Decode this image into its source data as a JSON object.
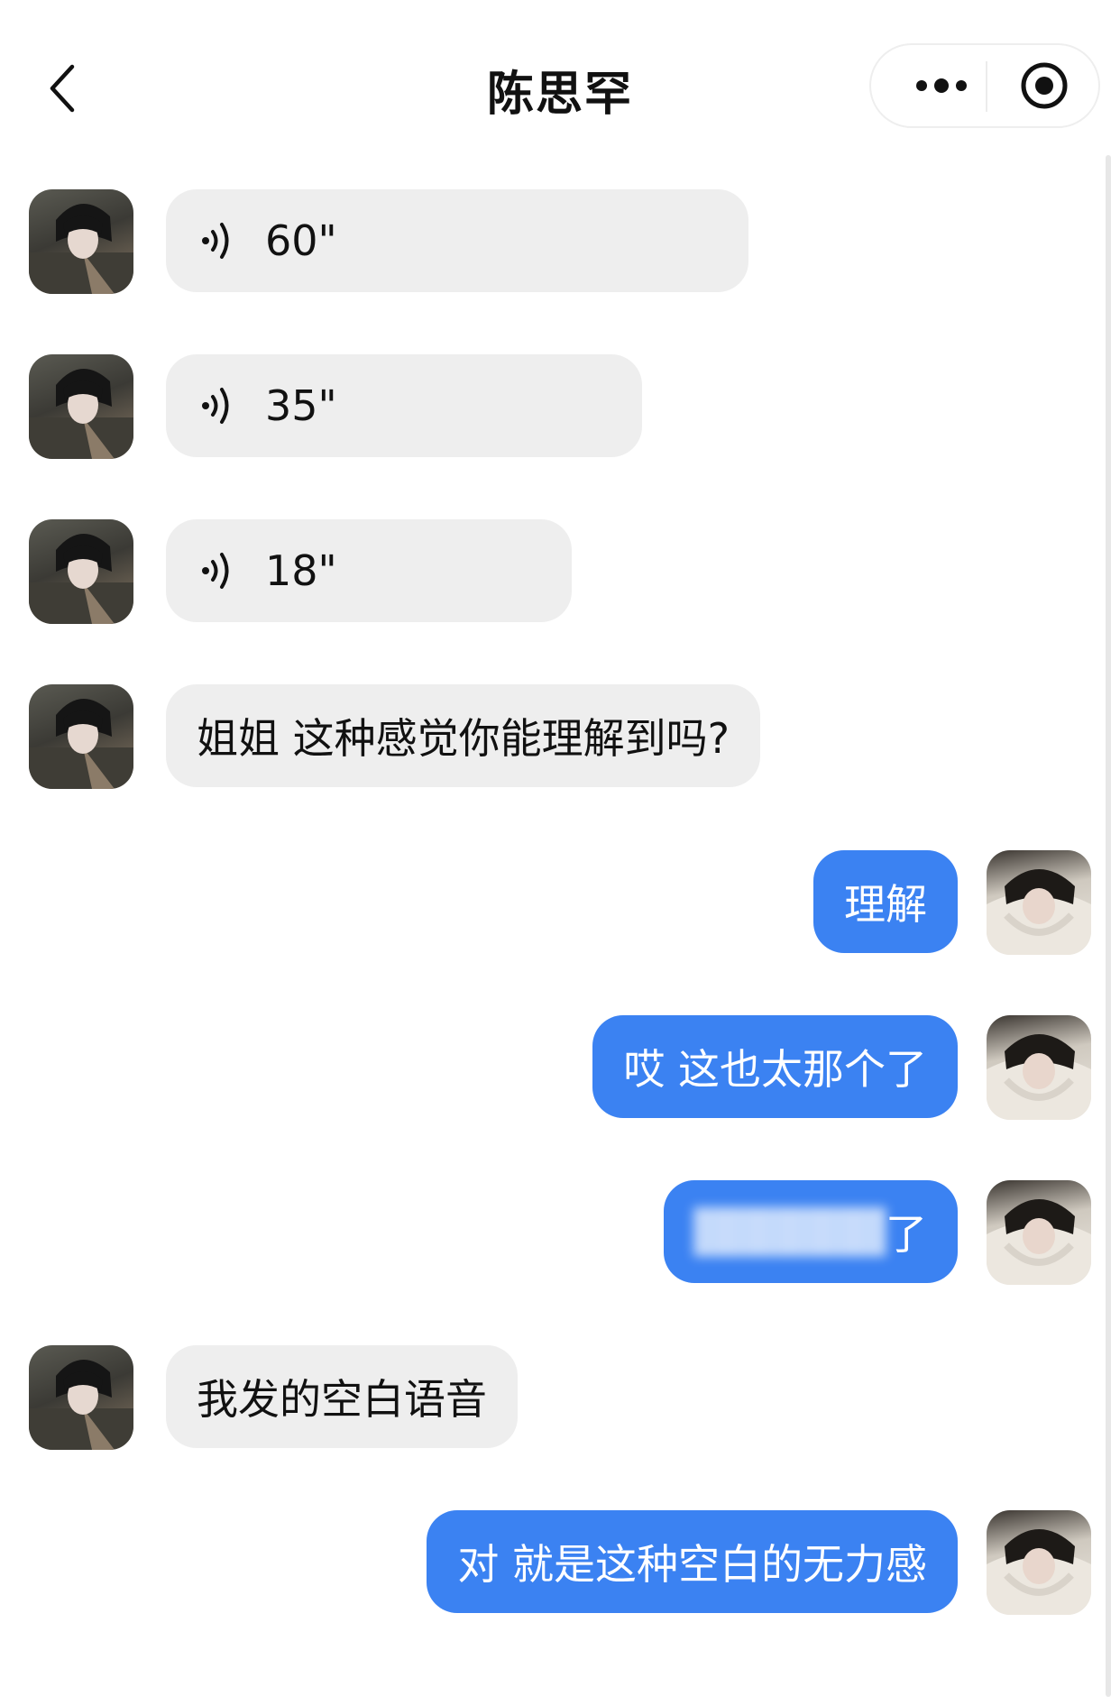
{
  "header": {
    "title": "陈思罕",
    "back_icon": "chevron-left-icon",
    "more_icon": "more-dots-icon",
    "close_icon": "target-icon"
  },
  "messages": [
    {
      "side": "in",
      "type": "voice",
      "duration": "60\""
    },
    {
      "side": "in",
      "type": "voice",
      "duration": "35\""
    },
    {
      "side": "in",
      "type": "voice",
      "duration": "18\""
    },
    {
      "side": "in",
      "type": "text",
      "text": "姐姐 这种感觉你能理解到吗?"
    },
    {
      "side": "out",
      "type": "text",
      "text": "理解"
    },
    {
      "side": "out",
      "type": "text",
      "text": "哎 这也太那个了"
    },
    {
      "side": "out",
      "type": "text",
      "text_visible_end": "了"
    },
    {
      "side": "in",
      "type": "text",
      "text": "我发的空白语音"
    },
    {
      "side": "out",
      "type": "text",
      "text": "对 就是这种空白的无力感"
    }
  ],
  "colors": {
    "outgoing_bubble": "#3b82f2",
    "incoming_bubble": "#eeeeee",
    "background": "#ffffff"
  }
}
